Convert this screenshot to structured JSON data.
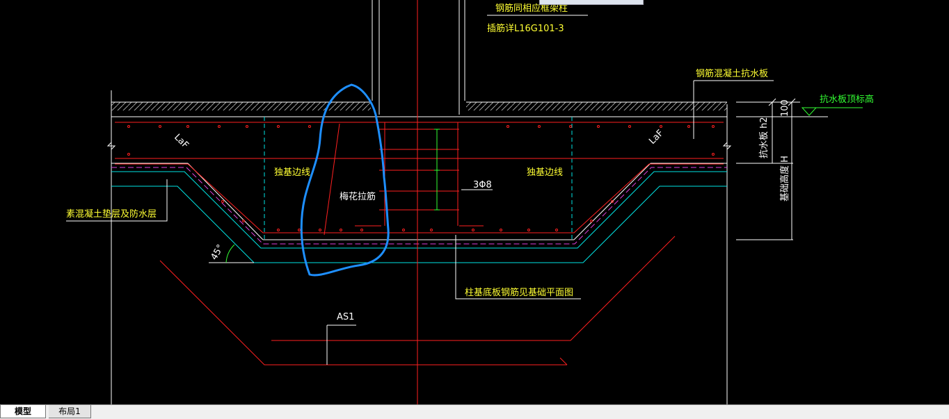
{
  "tabs": [
    {
      "label": "模型",
      "active": true
    },
    {
      "label": "布局1",
      "active": false
    }
  ],
  "labels": {
    "rebar_same_col": "钢筋同相应框架柱",
    "dowel_ref": "插筋详L16G101-3",
    "antiwater_slab": "钢筋混凝土抗水板",
    "antiwater_top": "抗水板顶标高",
    "dim_100": "100",
    "thickness_h2": "抗水板 h2",
    "found_height": "基础高度 H",
    "laf_left": "LaF",
    "laf_right": "LaF",
    "edge_line_left": "独基边线",
    "edge_line_right": "独基边线",
    "tie_bar": "梅花拉筋",
    "stirrup": "3Φ8",
    "bedding": "素混凝土垫层及防水层",
    "angle": "45°",
    "bottom_rebar": "柱基底板钢筋见基础平面图",
    "section": "AS1"
  },
  "colors": {
    "background": "#000000",
    "red_line": "#ff2020",
    "cyan_line": "#00e5e5",
    "white_line": "#ffffff",
    "text_yellow": "#ffff33",
    "text_green": "#33ff33",
    "magenta_dash": "#e040e0",
    "annotation_blue": "#1e8fff"
  }
}
